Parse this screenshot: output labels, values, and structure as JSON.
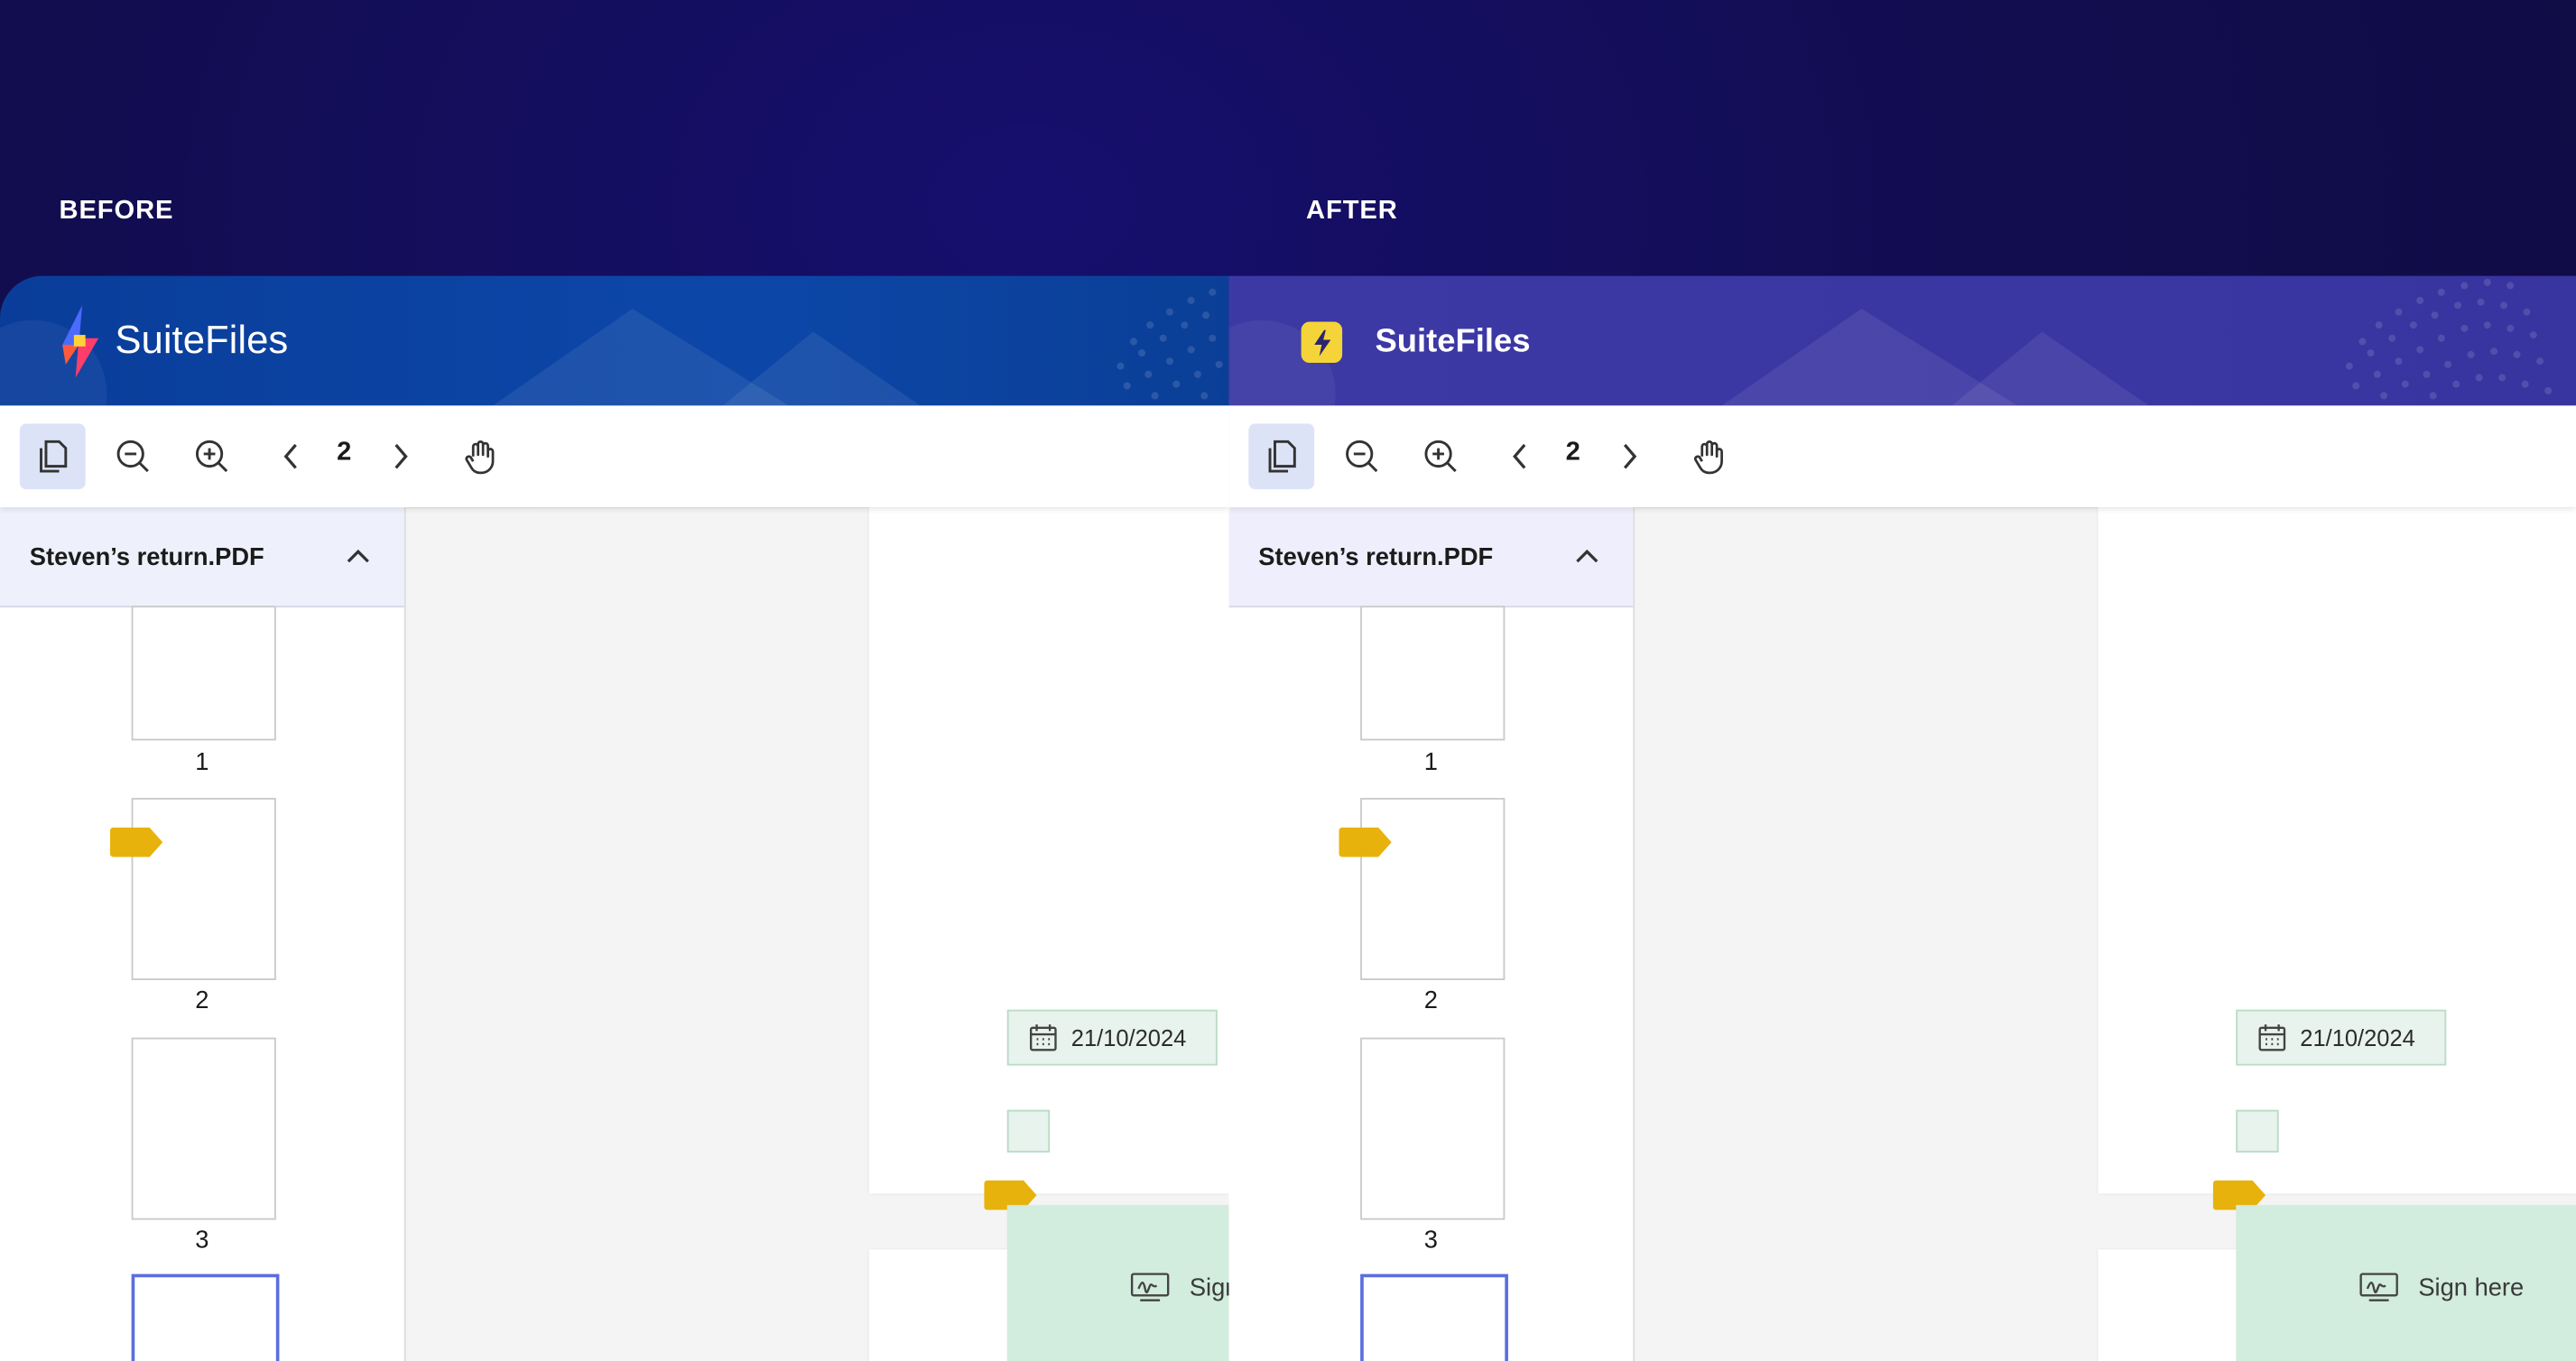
{
  "labels": {
    "before": "BEFORE",
    "after": "AFTER"
  },
  "before": {
    "brand": "SuiteFiles",
    "toolbar": {
      "page_number": "2"
    },
    "sidebar": {
      "file_name": "Steven’s return.PDF",
      "pages": [
        "1",
        "2",
        "3"
      ]
    },
    "fields": {
      "date": "21/10/2024",
      "sign": "Sign here"
    }
  },
  "after": {
    "brand": "SuiteFiles",
    "toolbar": {
      "page_number": "2"
    },
    "sidebar": {
      "file_name": "Steven’s return.PDF",
      "pages": [
        "1",
        "2",
        "3"
      ]
    },
    "fields": {
      "date": "21/10/2024",
      "sign": "Sign here"
    }
  },
  "colors": {
    "background": "#120d4f",
    "before_header": "#0c47a8",
    "after_header": "#3c38a4",
    "field_green": "#d2ecdd",
    "tag_yellow": "#e8b20c",
    "selected_thumb": "#5a6ee0"
  },
  "icons": [
    "pages-icon",
    "zoom-out-icon",
    "zoom-in-icon",
    "chevron-left-icon",
    "chevron-right-icon",
    "hand-pan-icon",
    "chevron-up-icon",
    "calendar-icon",
    "signature-icon",
    "tag-marker-icon"
  ]
}
